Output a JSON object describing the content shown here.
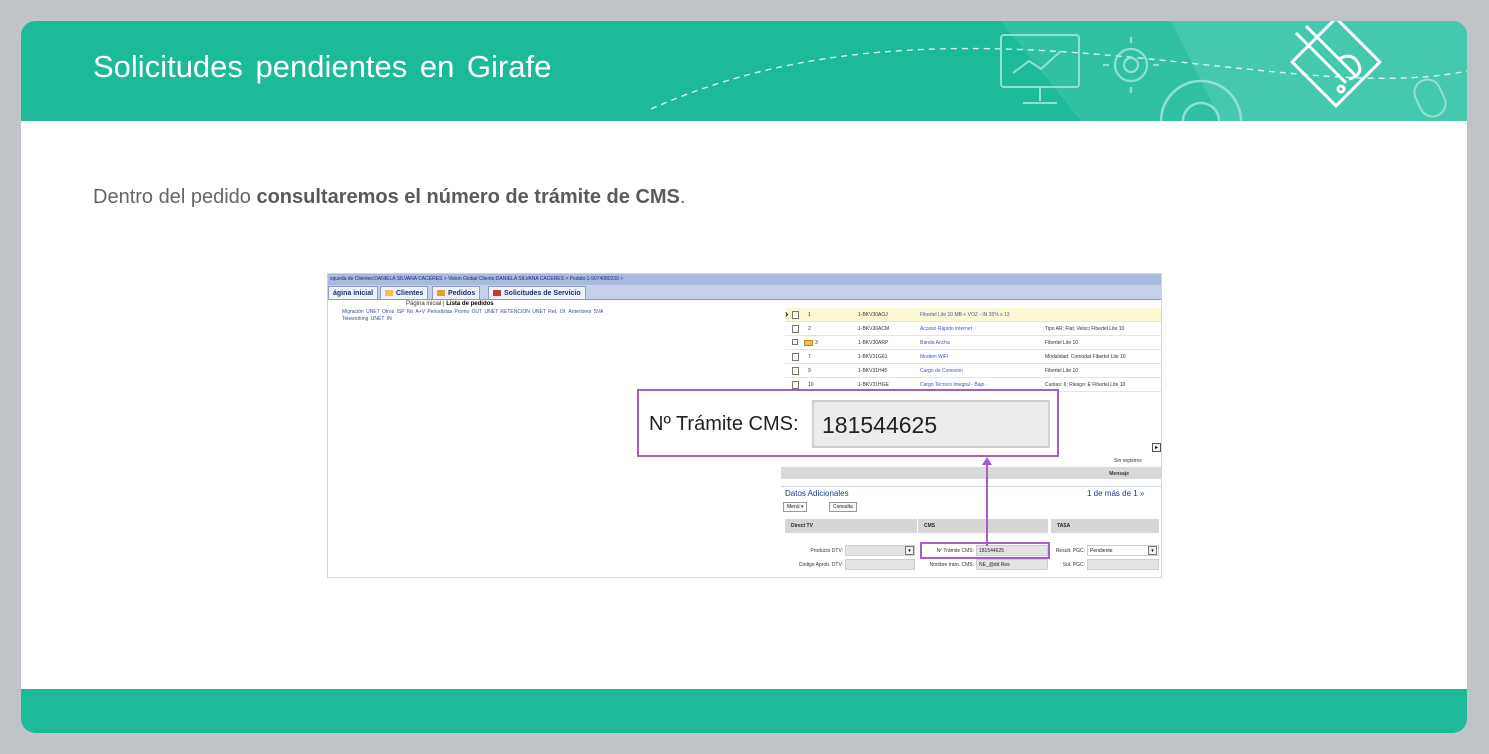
{
  "header": {
    "title": "Solicitudes pendientes en Girafe"
  },
  "intro": {
    "prefix": "Dentro del pedido ",
    "bold": "consultaremos el número de trámite de CMS",
    "suffix": "."
  },
  "screenshot": {
    "breadcrumb": "squeda de Clientes:DANIELA SILVANA CACERES > Vision Global Cliente:DANIELA SILVANA CACERES > Pedido:1-9074080230 >",
    "tabs": [
      {
        "label": "ágina inicial"
      },
      {
        "label": "Clientes"
      },
      {
        "label": "Pedidos"
      },
      {
        "label": "Solicitudes de Servicio"
      }
    ],
    "subnav": {
      "home": "Página inicial",
      "sep": "|",
      "current": "Lista de pedidos"
    },
    "links_row1": "Migración UNET    Otros ISP No A+V    Periodistas    Promo OUT UNET    RETENCION UNET    Ret. Of. Anteriores    SVA",
    "links_row2": "Teleworking    UNET IN",
    "rows": [
      {
        "num": "1",
        "id": "1-BKV30AOJ",
        "product": "Fibertel Lite 10 MB + VOZ - IN 35% x 12",
        "detail": ""
      },
      {
        "num": "2",
        "id": "1-BKV30ACM",
        "product": "Acceso Rápido Internet",
        "detail": "Tipo AR: Flat; Veloci Fibertel Lite 10"
      },
      {
        "num": "3",
        "id": "1-BKV30ARP",
        "product": "Banda Ancha",
        "detail": "Fibertel Lite 10"
      },
      {
        "num": "7",
        "id": "1-BKV31G61",
        "product": "Modem WiFi",
        "detail": "Modalidad: Comodat Fibertel Lite 10"
      },
      {
        "num": "9",
        "id": "1-BKV31H45",
        "product": "Cargo de Conexion",
        "detail": "Fibertel Lite 10"
      },
      {
        "num": "10",
        "id": "1-BKV31HGE",
        "product": "Cargo Tecnico Integral - Bajo",
        "detail": "Cuotas: 6; Riesgo: E Fibertel Lite 10"
      }
    ],
    "sin_registros": "Sin registros",
    "mensaje": "Mensaje",
    "datos_title": "Datos Adicionales",
    "datos_pager": "1 de más de 1 »",
    "menu_button": "Menú ▾",
    "consulta_button": "Consulta",
    "col_direct_tv": "Direct TV",
    "col_cms": "CMS",
    "col_tasa": "TASA",
    "producto_dtv_label": "Producto DTV:",
    "codigo_aprob_label": "Código Aprob. DTV:",
    "tramite_label_small": "Nº Trámite CMS:",
    "tramite_value_small": "181544625",
    "nombre_tram_label": "Nombre tram. CMS:",
    "nombre_tram_value": "NE_@dd Res",
    "result_pgc_label": "Result. PGC:",
    "result_pgc_value": "Pendiente",
    "sol_pgc_label": "Sol. PGC:"
  },
  "callout": {
    "label": "Nº Trámite CMS:",
    "value": "181544625"
  },
  "colors": {
    "teal": "#1dba9a",
    "highlight": "#a55ec6"
  }
}
